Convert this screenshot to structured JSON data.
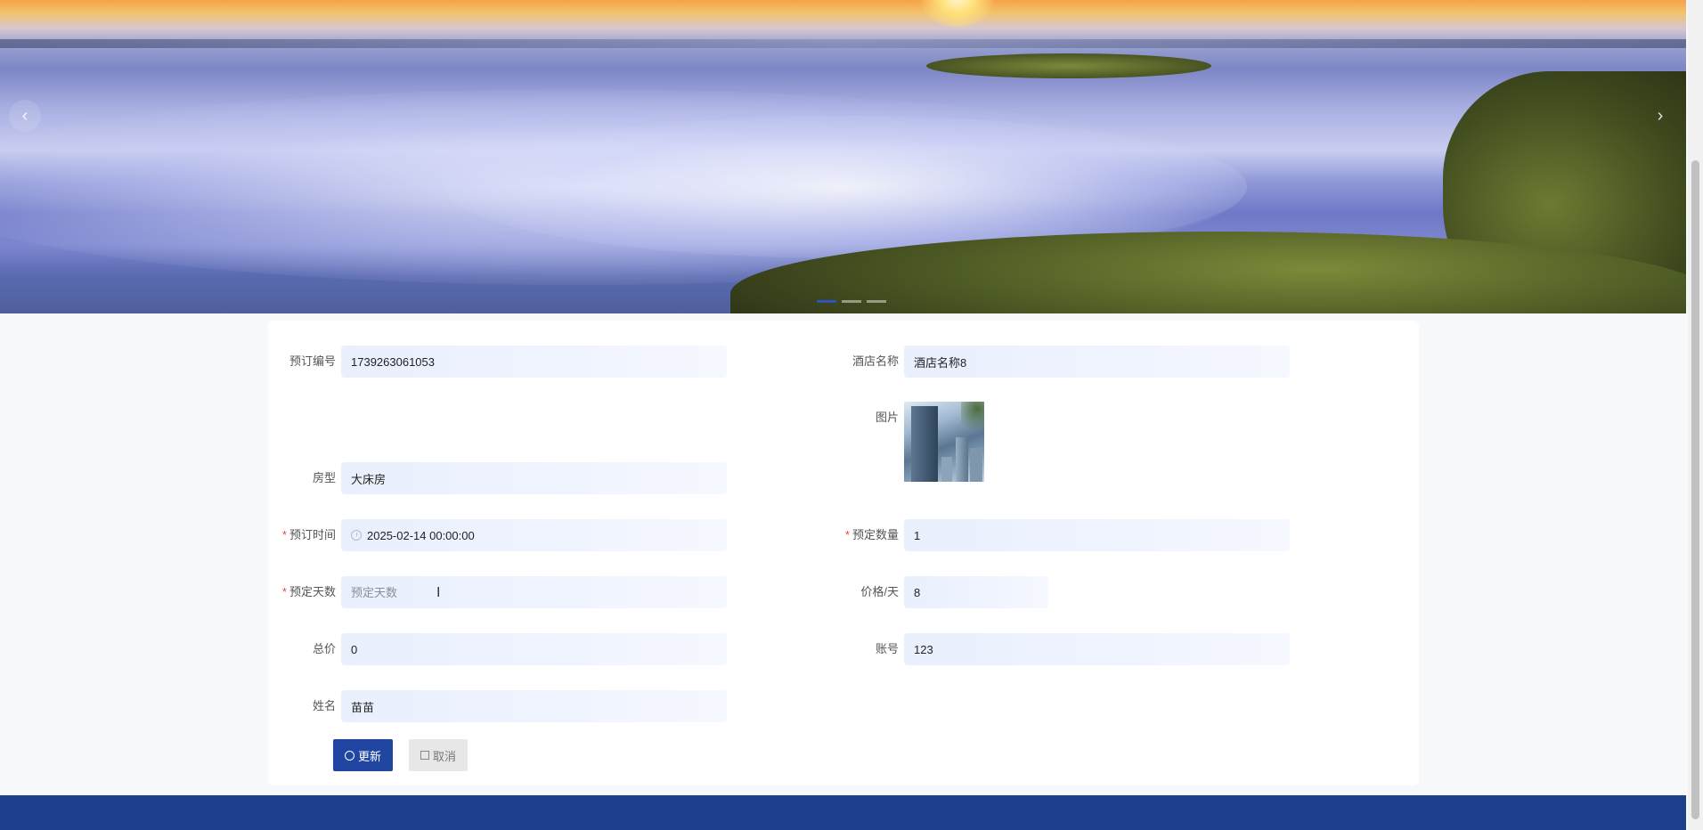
{
  "banner": {
    "prev_arrow": "‹",
    "next_arrow": "›",
    "slide_count": 3,
    "active_slide": 1
  },
  "form": {
    "order_no": {
      "label": "预订编号",
      "value": "1739263061053",
      "required": false
    },
    "hotel_name": {
      "label": "酒店名称",
      "value": "酒店名称8",
      "required": false
    },
    "image": {
      "label": "图片"
    },
    "room_type": {
      "label": "房型",
      "value": "大床房",
      "required": false
    },
    "booking_time": {
      "label": "预订时间",
      "value": "2025-02-14 00:00:00",
      "required": true
    },
    "booking_qty": {
      "label": "预定数量",
      "value": "1",
      "required": true
    },
    "booking_days": {
      "label": "预定天数",
      "value": "",
      "placeholder": "预定天数",
      "required": true
    },
    "price_per_day": {
      "label": "价格/天",
      "value": "8",
      "required": false
    },
    "total_price": {
      "label": "总价",
      "value": "0",
      "required": false
    },
    "account": {
      "label": "账号",
      "value": "123",
      "required": false
    },
    "name": {
      "label": "姓名",
      "value": "苗苗",
      "required": false
    }
  },
  "actions": {
    "update_label": "更新",
    "cancel_label": "取消"
  },
  "colors": {
    "primary": "#2146a2",
    "footer": "#1c3f8e",
    "required": "#e74c3c"
  }
}
